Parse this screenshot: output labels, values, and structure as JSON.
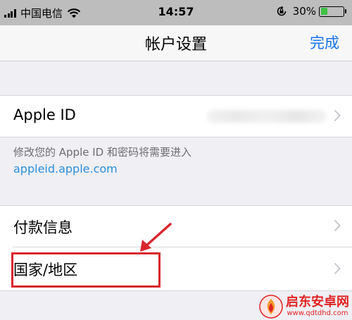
{
  "status_bar": {
    "carrier": "中国电信",
    "time": "14:57",
    "battery_percent": "30%",
    "battery_level": 0.3,
    "battery_color": "#3ec144"
  },
  "nav": {
    "title": "帐户设置",
    "done_label": "完成",
    "accent_color": "#1a73e8"
  },
  "apple_id_section": {
    "label": "Apple ID",
    "note": "修改您的 Apple ID 和密码将需要进入",
    "link": "appleid.apple.com"
  },
  "settings_section": {
    "items": [
      {
        "label": "付款信息"
      },
      {
        "label": "国家/地区"
      }
    ]
  },
  "watermark": {
    "name": "启东安卓网",
    "url": "www.qdtdhd.com"
  }
}
